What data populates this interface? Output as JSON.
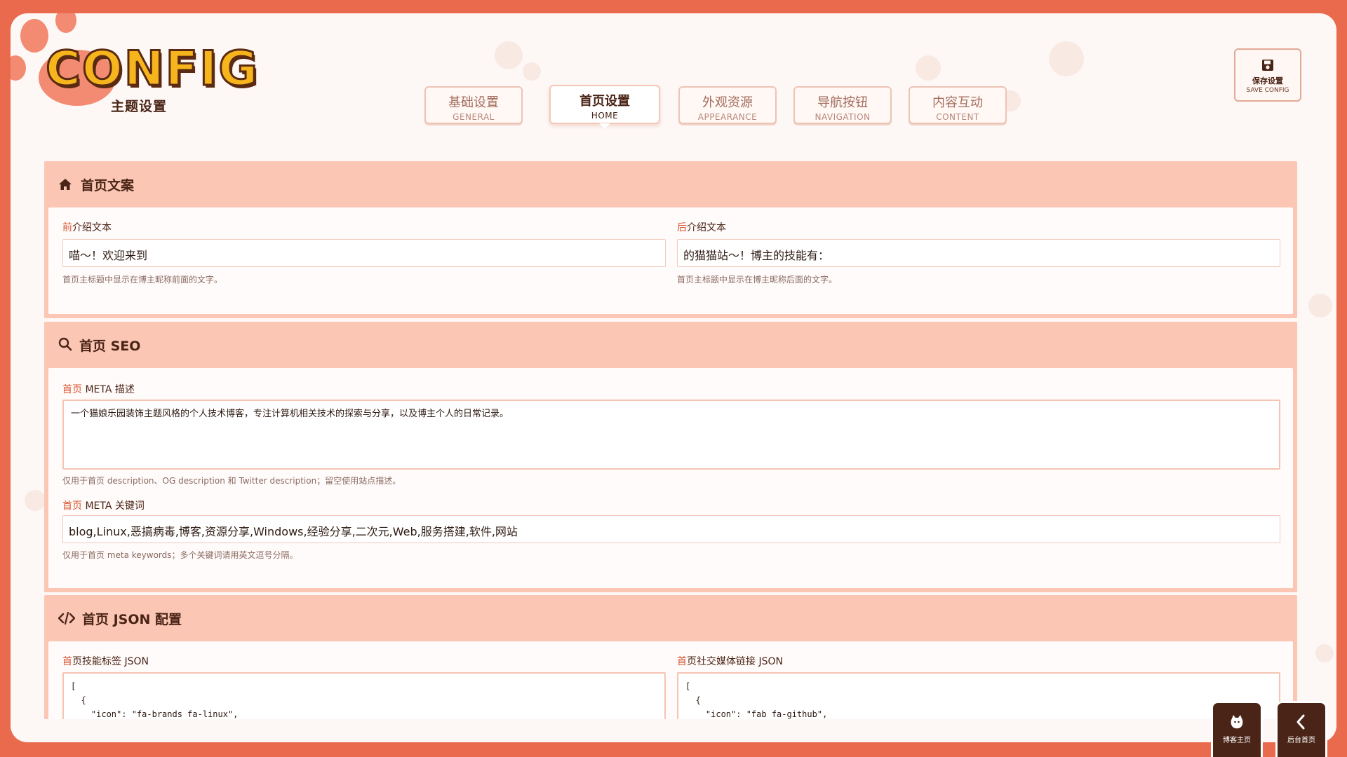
{
  "logo": {
    "title": "CONFIG",
    "subtitle": "主题设置"
  },
  "tabs": [
    {
      "cn": "基础设置",
      "en": "GENERAL",
      "active": false
    },
    {
      "cn": "首页设置",
      "en": "HOME",
      "active": true
    },
    {
      "cn": "外观资源",
      "en": "APPEARANCE",
      "active": false
    },
    {
      "cn": "导航按钮",
      "en": "NAVIGATION",
      "active": false
    },
    {
      "cn": "内容互动",
      "en": "CONTENT",
      "active": false
    }
  ],
  "save": {
    "label": "保存设置",
    "sublabel": "SAVE CONFIG"
  },
  "sections": {
    "copy": {
      "title": "首页文案",
      "before_label_accent": "前",
      "before_label_rest": "介绍文本",
      "before_value": "喵～！欢迎来到",
      "before_hint": "首页主标题中显示在博主昵称前面的文字。",
      "after_label_accent": "后",
      "after_label_rest": "介绍文本",
      "after_value": "的猫猫站～！博主的技能有：",
      "after_hint": "首页主标题中显示在博主昵称后面的文字。"
    },
    "seo": {
      "title": "首页 SEO",
      "desc_label_accent": "首页",
      "desc_label_rest": " META 描述",
      "desc_value": "一个猫娘乐园装饰主题风格的个人技术博客，专注计算机相关技术的探索与分享，以及博主个人的日常记录。",
      "desc_hint": "仅用于首页 description、OG description 和 Twitter description；留空使用站点描述。",
      "kw_label_accent": "首页",
      "kw_label_rest": " META 关键词",
      "kw_value": "blog,Linux,恶搞病毒,博客,资源分享,Windows,经验分享,二次元,Web,服务搭建,软件,网站",
      "kw_hint": "仅用于首页 meta keywords；多个关键词请用英文逗号分隔。"
    },
    "json": {
      "title": "首页 JSON 配置",
      "skills_label_accent": "首",
      "skills_label_rest": "页技能标签 JSON",
      "skills_code": "[\n  {\n    \"icon\": \"fa-brands fa-linux\",",
      "social_label_accent": "首",
      "social_label_rest": "页社交媒体链接 JSON",
      "social_code": "[\n  {\n    \"icon\": \"fab fa-github\","
    }
  },
  "float": {
    "home_label": "博客主页",
    "admin_label": "后台首页"
  }
}
